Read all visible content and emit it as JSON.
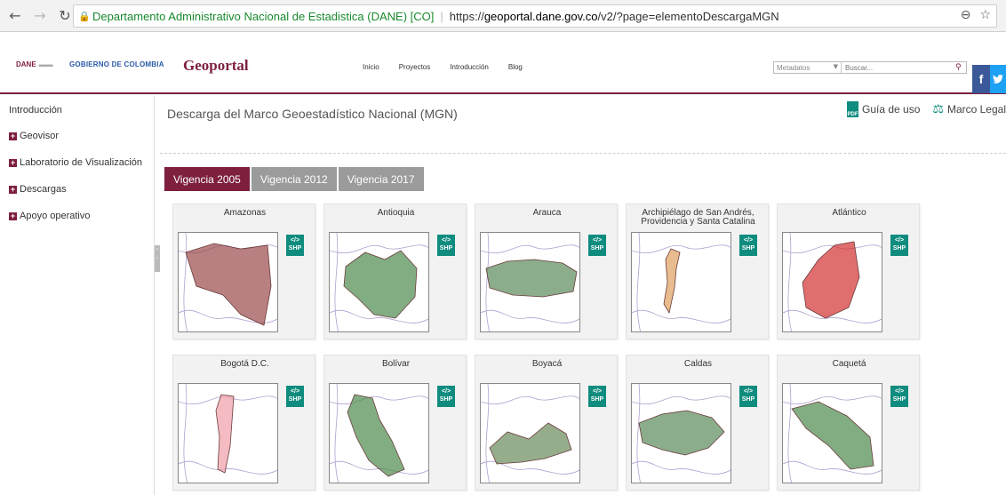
{
  "browser": {
    "site_identity": "Departamento Administrativo Nacional de Estadistica (DANE) [CO]",
    "url_prefix": "https://",
    "url_host": "geoportal.dane.gov.co",
    "url_path": "/v2/?page=elementoDescargaMGN"
  },
  "header": {
    "logo_dane": "DANE",
    "logo_gov": "GOBIERNO DE COLOMBIA",
    "brand": "Geoportal",
    "nav": [
      "Inicio",
      "Proyectos",
      "Introducción",
      "Blog"
    ],
    "search_select": "Metadatos",
    "search_placeholder": "Buscar...",
    "facebook": "f"
  },
  "sidebar": {
    "items": [
      {
        "label": "Introducción",
        "plus": false
      },
      {
        "label": "Geovisor",
        "plus": true
      },
      {
        "label": "Laboratorio de Visualización",
        "plus": true
      },
      {
        "label": "Descargas",
        "plus": true
      },
      {
        "label": "Apoyo operativo",
        "plus": true
      }
    ]
  },
  "main": {
    "title": "Descarga del Marco Geoestadístico Nacional (MGN)",
    "guide_link": "Guía de uso",
    "legal_link": "Marco Legal",
    "pdf_label": "PDF",
    "tabs": [
      "Vigencia 2005",
      "Vigencia 2012",
      "Vigencia 2017"
    ],
    "active_tab": 0,
    "shp_label_1": "</>",
    "shp_label_2": "SHP",
    "cards": [
      {
        "name": "Amazonas",
        "color": "#9a4a4a"
      },
      {
        "name": "Antioquia",
        "color": "#4d8a4d"
      },
      {
        "name": "Arauca",
        "color": "#5a8a5a"
      },
      {
        "name": "Archipiélago de San Andrés, Providencia y Santa Catalina",
        "color": "#e0a060"
      },
      {
        "name": "Atlántico",
        "color": "#d43030"
      },
      {
        "name": "Bogotá D.C.",
        "color": "#f0a0a8"
      },
      {
        "name": "Bolívar",
        "color": "#4d8a4d"
      },
      {
        "name": "Boyacá",
        "color": "#6a8a5a"
      },
      {
        "name": "Caldas",
        "color": "#5a8a5a"
      },
      {
        "name": "Caquetá",
        "color": "#4d8a4d"
      }
    ]
  }
}
